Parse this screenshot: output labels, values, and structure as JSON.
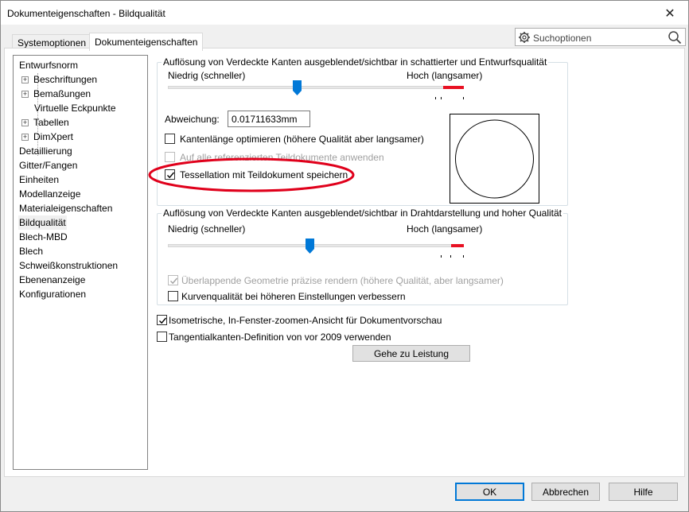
{
  "window": {
    "title": "Dokumenteigenschaften - Bildqualität",
    "close_glyph": "✕"
  },
  "tabs": [
    {
      "label": "Systemoptionen",
      "active": false
    },
    {
      "label": "Dokumenteigenschaften",
      "active": true
    }
  ],
  "search": {
    "placeholder": "Suchoptionen",
    "icon": "gear-icon",
    "button_icon": "search-icon"
  },
  "tree": {
    "items": [
      {
        "label": "Entwurfsnorm",
        "level": 0,
        "expandable": false
      },
      {
        "label": "Beschriftungen",
        "level": 1,
        "expandable": true
      },
      {
        "label": "Bemaßungen",
        "level": 1,
        "expandable": true
      },
      {
        "label": "Virtuelle Eckpunkte",
        "level": 1,
        "expandable": false
      },
      {
        "label": "Tabellen",
        "level": 1,
        "expandable": true
      },
      {
        "label": "DimXpert",
        "level": 1,
        "expandable": true
      },
      {
        "label": "Detaillierung",
        "level": 0,
        "expandable": false
      },
      {
        "label": "Gitter/Fangen",
        "level": 0,
        "expandable": false
      },
      {
        "label": "Einheiten",
        "level": 0,
        "expandable": false
      },
      {
        "label": "Modellanzeige",
        "level": 0,
        "expandable": false
      },
      {
        "label": "Materialeigenschaften",
        "level": 0,
        "expandable": false
      },
      {
        "label": "Bildqualität",
        "level": 0,
        "expandable": false,
        "selected": true
      },
      {
        "label": "Blech-MBD",
        "level": 0,
        "expandable": false
      },
      {
        "label": "Blech",
        "level": 0,
        "expandable": false
      },
      {
        "label": "Schweißkonstruktionen",
        "level": 0,
        "expandable": false
      },
      {
        "label": "Ebenenanzeige",
        "level": 0,
        "expandable": false
      },
      {
        "label": "Konfigurationen",
        "level": 0,
        "expandable": false
      }
    ]
  },
  "shaded": {
    "title": "Auflösung von Verdeckte Kanten ausgeblendet/sichtbar in schattierter und Entwurfsqualität",
    "low_label": "Niedrig (schneller)",
    "high_label": "Hoch (langsamer)",
    "slider_position": 0.44,
    "deviation_label": "Abweichung:",
    "deviation_value": "0.01711633mm",
    "checkboxes": [
      {
        "label": "Kantenlänge optimieren (höhere Qualität aber langsamer)",
        "checked": false,
        "disabled": false
      },
      {
        "label": "Auf alle referenzierten Teildokumente anwenden",
        "checked": false,
        "disabled": true
      },
      {
        "label": "Tessellation mit Teildokument speichern",
        "checked": true,
        "disabled": false
      }
    ]
  },
  "wireframe": {
    "title": "Auflösung von Verdeckte Kanten ausgeblendet/sichtbar in Drahtdarstellung und hoher Qualität",
    "low_label": "Niedrig (schneller)",
    "high_label": "Hoch (langsamer)",
    "slider_position": 0.48,
    "checkboxes": [
      {
        "label": "Überlappende Geometrie präzise rendern (höhere Qualität, aber langsamer)",
        "checked": true,
        "disabled": true
      },
      {
        "label": "Kurvenqualität bei höheren Einstellungen verbessern",
        "checked": false,
        "disabled": false
      }
    ]
  },
  "options": [
    {
      "label": "Isometrische, In-Fenster-zoomen-Ansicht für Dokumentvorschau",
      "checked": true
    },
    {
      "label": "Tangentialkanten-Definition von vor 2009 verwenden",
      "checked": false
    }
  ],
  "performance_button": "Gehe zu Leistung",
  "footer": {
    "ok": "OK",
    "cancel": "Abbrechen",
    "help": "Hilfe"
  },
  "colors": {
    "slider_thumb": "#0078d7",
    "slider_high": "#e81123",
    "annotation": "#e0001b"
  }
}
